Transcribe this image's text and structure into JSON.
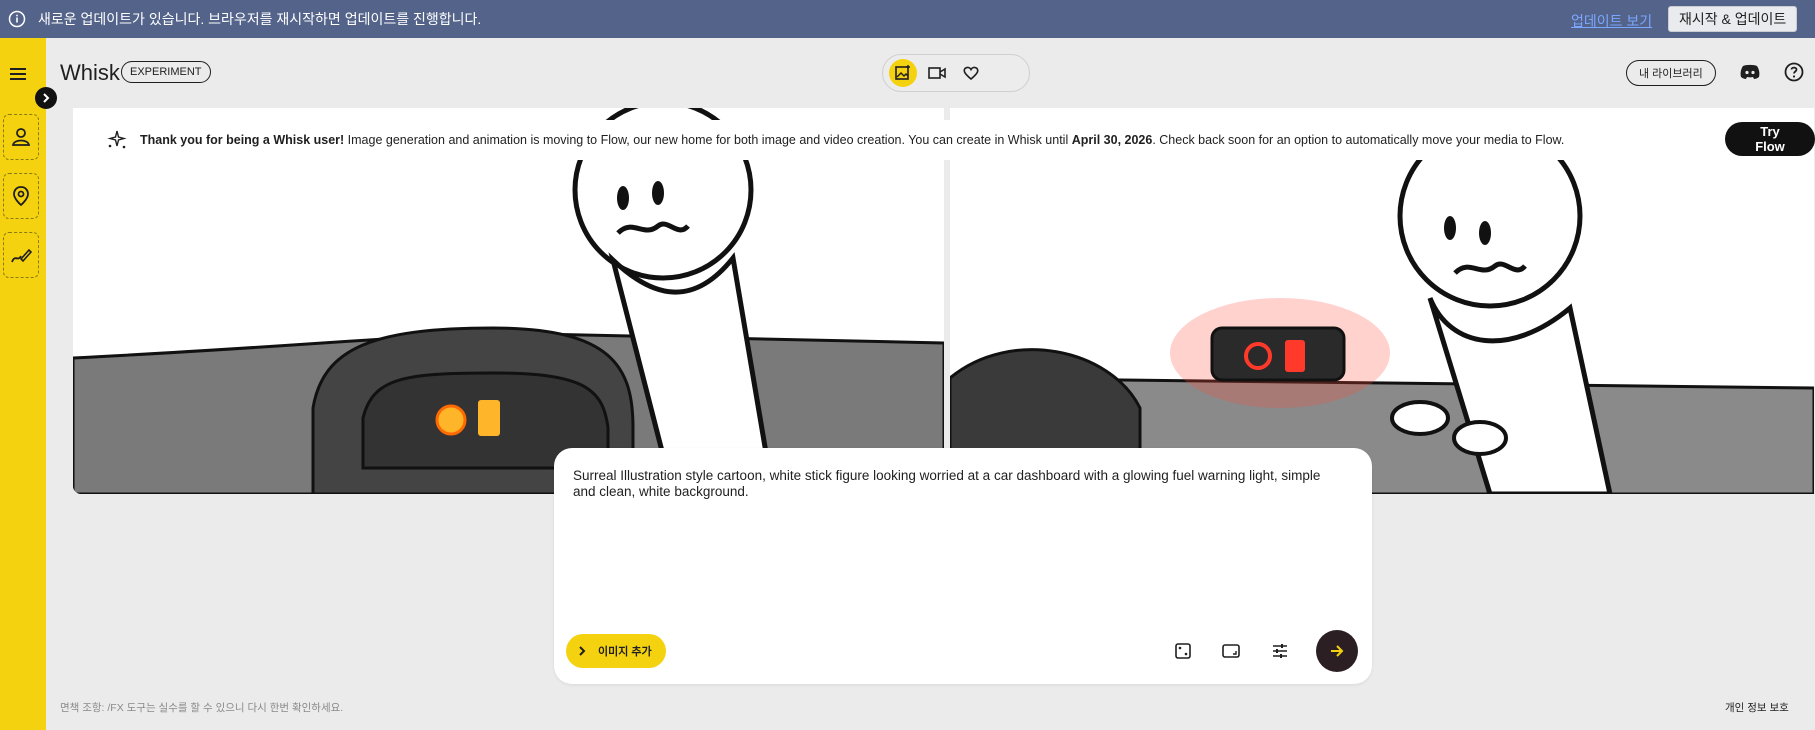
{
  "update_bar": {
    "message": "새로운 업데이트가 있습니다. 브라우저를 재시작하면 업데이트를 진행합니다.",
    "view_update_link": "업데이트 보기",
    "restart_button": "재시작 & 업데이트",
    "background": "#53638a"
  },
  "header": {
    "app_name": "Whisk",
    "badge": "EXPERIMENT",
    "library_button": "내 라이브러리",
    "modes": [
      "image-mode-icon",
      "video-mode-icon",
      "favorites-heart-icon"
    ],
    "active_mode": "image-mode-icon"
  },
  "sidebar": {
    "items": [
      "person-subject-icon",
      "location-scene-icon",
      "brush-style-icon"
    ],
    "accent": "#f5d20f"
  },
  "banner": {
    "lead": "Thank you for being a Whisk user!",
    "body_1": " Image generation and animation is moving to Flow, our new home for both image and video creation. You can create in Whisk until ",
    "date": "April 30, 2026",
    "body_2": ". Check back soon for an option to automatically move your media to Flow.",
    "cta": "Try Flow"
  },
  "prompt": {
    "text": "Surreal Illustration  style cartoon, white stick figure looking worried at a car dashboard with a glowing fuel warning light, simple and clean, white background.",
    "add_image_button": "이미지 추가",
    "tools": [
      "dice-random-icon",
      "aspect-ratio-icon",
      "settings-sliders-icon"
    ]
  },
  "footer": {
    "disclaimer": "면책 조항: /FX 도구는 실수를 할 수 있으니 다시 한번 확인하세요.",
    "privacy": "개인 정보 보호"
  }
}
